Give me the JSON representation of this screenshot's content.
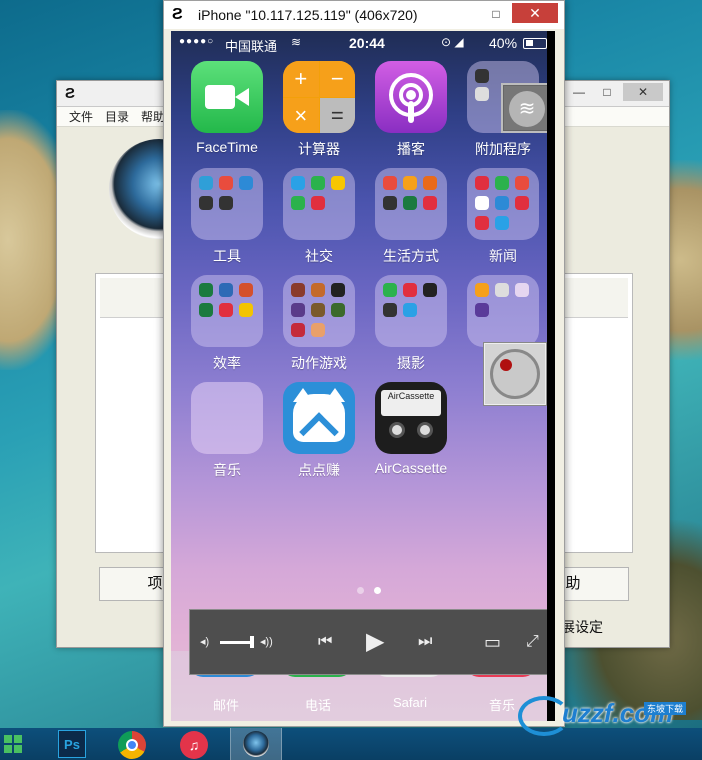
{
  "phone_window": {
    "title": "iPhone \"10.117.125.119\" (406x720)",
    "minimize_label": "□",
    "close_label": "✕"
  },
  "status_bar": {
    "signal": "●●●●○",
    "carrier": "中国联通",
    "wifi_glyph": "WiFi",
    "time": "20:44",
    "icons": "⊙ ◢",
    "battery": "40%"
  },
  "apps": [
    {
      "label": "FaceTime"
    },
    {
      "label": "计算器"
    },
    {
      "label": "播客"
    },
    {
      "label": "附加程序"
    },
    {
      "label": "工具"
    },
    {
      "label": "社交"
    },
    {
      "label": "生活方式"
    },
    {
      "label": "新闻"
    },
    {
      "label": "效率"
    },
    {
      "label": "动作游戏"
    },
    {
      "label": "摄影"
    },
    {
      "label": ""
    },
    {
      "label": "音乐"
    },
    {
      "label": "点点赚"
    },
    {
      "label": "AirCassette"
    }
  ],
  "calculator_keys": [
    "+",
    "−",
    "×",
    "="
  ],
  "cassette_label": "AirCassette",
  "dock": {
    "items": [
      "邮件",
      "电话",
      "Safari",
      "音乐"
    ]
  },
  "player": {
    "vol_low": "◂)",
    "vol_high": "◂))",
    "prev": "⏮",
    "play": "▶",
    "next": "⏭",
    "airplay": "▭",
    "fullscreen": "⤢"
  },
  "bg_window": {
    "menu": [
      "文件",
      "目录",
      "帮助"
    ],
    "btn_left": "项",
    "btn_right": "助",
    "footer_text": "展设定"
  },
  "taskbar": {
    "ps_label": "Ps",
    "itunes_glyph": "♫"
  },
  "watermark": {
    "text": "uzzf.com",
    "small": "东坡下载"
  },
  "colors": {
    "close_red": "#c7403a",
    "record_red": "#b01010",
    "facetime_green": "#23b84a",
    "calc_orange": "#f3a00a"
  }
}
